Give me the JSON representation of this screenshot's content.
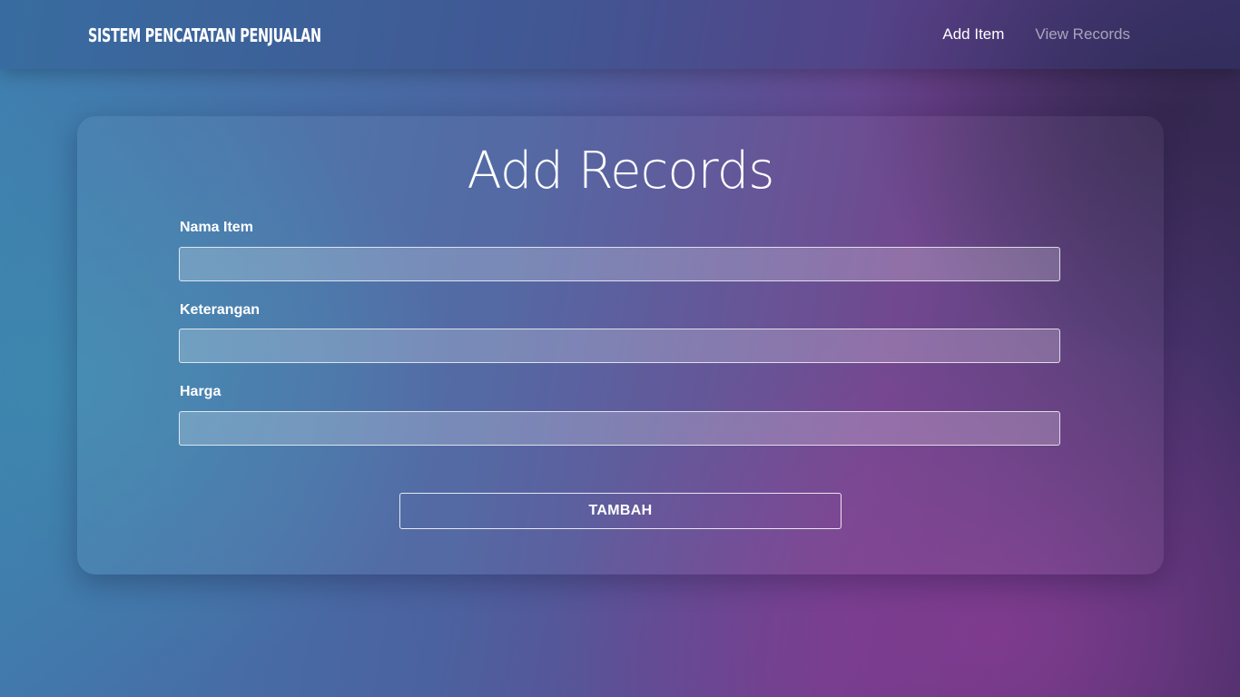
{
  "navbar": {
    "brand": "SISTEM PENCATATAN PENJUALAN",
    "links": [
      {
        "label": "Add Item",
        "active": true
      },
      {
        "label": "View Records",
        "active": false
      }
    ]
  },
  "form": {
    "title": "Add Records",
    "fields": [
      {
        "label": "Nama Item",
        "value": "",
        "placeholder": ""
      },
      {
        "label": "Keterangan",
        "value": "",
        "placeholder": ""
      },
      {
        "label": "Harga",
        "value": "",
        "placeholder": ""
      }
    ],
    "submit_label": "TAMBAH"
  },
  "colors": {
    "text": "#ffffff",
    "muted_link": "rgba(255,255,255,0.55)",
    "gradient_blue": "#3f7fb0",
    "gradient_purple": "#6a3f8a",
    "gradient_dark": "#3a2d5e"
  }
}
